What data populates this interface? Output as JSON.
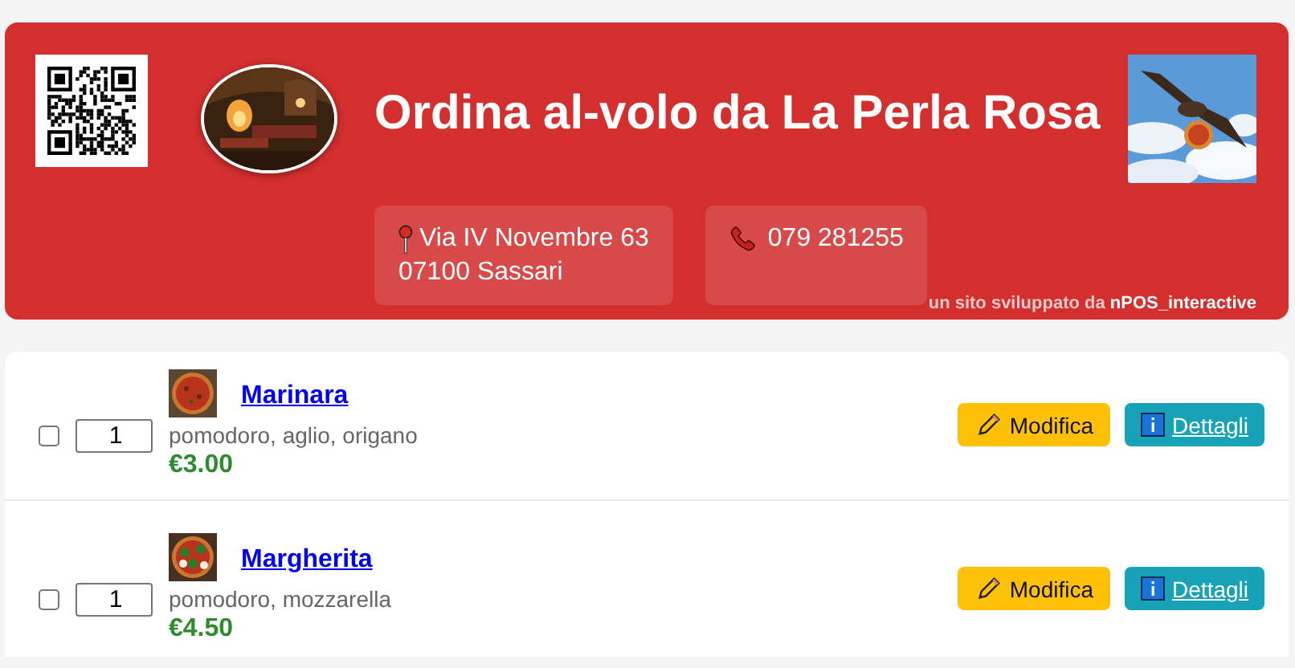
{
  "header": {
    "title": "Ordina al-volo da La Perla Rosa",
    "address_lines": [
      "Via IV Novembre 63",
      "07100 Sassari"
    ],
    "phone": "079 281255",
    "credit": "un sito sviluppato da **nPOS_interactive**"
  },
  "items": [
    {
      "name": "Marinara",
      "description": "pomodoro, aglio, origano",
      "price": "€3.00",
      "quantity": "1",
      "checked": false,
      "edit_label": "Modifica",
      "details_label": "Dettagli"
    },
    {
      "name": "Margherita",
      "description": "pomodoro, mozzarella",
      "price": "€4.50",
      "quantity": "1",
      "checked": false,
      "edit_label": "Modifica",
      "details_label": "Dettagli"
    }
  ]
}
